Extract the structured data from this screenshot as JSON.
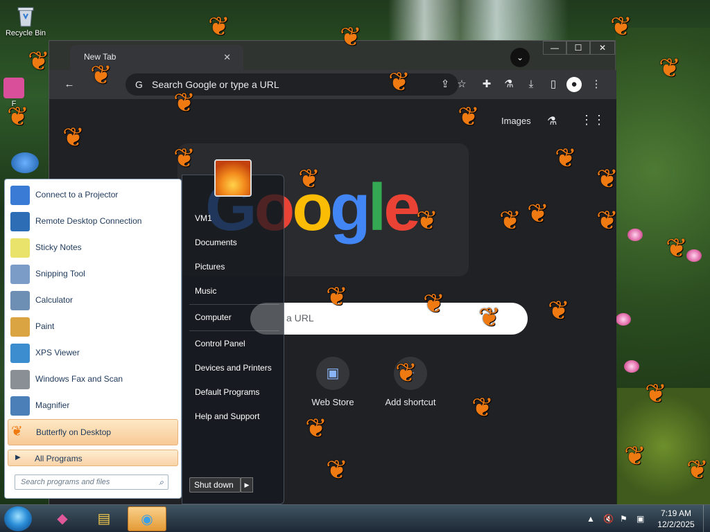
{
  "desktop": {
    "recycle_bin_label": "Recycle Bin",
    "partial_icon_label": "F"
  },
  "browser": {
    "tab_title": "New Tab",
    "tab_close": "✕",
    "tab_search_icon": "⌄",
    "window_buttons": {
      "minimize": "—",
      "maximize": "☐",
      "close": "✕"
    },
    "omnibox_placeholder": "Search Google or type a URL",
    "images_link": "Images",
    "search_placeholder": "Search Google or type a URL",
    "search_visible": "a URL",
    "shortcuts": [
      {
        "label": "Web Store",
        "icon": "web-store-icon"
      },
      {
        "label": "Add shortcut",
        "icon": "plus-icon"
      }
    ]
  },
  "start_menu": {
    "programs": [
      {
        "label": "Connect to a Projector",
        "icon": "projector-icon",
        "color": "#3a7bd5"
      },
      {
        "label": "Remote Desktop Connection",
        "icon": "remote-desktop-icon",
        "color": "#2d6db5"
      },
      {
        "label": "Sticky Notes",
        "icon": "sticky-notes-icon",
        "color": "#e9e26b"
      },
      {
        "label": "Snipping Tool",
        "icon": "scissors-icon",
        "color": "#7a9cc6"
      },
      {
        "label": "Calculator",
        "icon": "calculator-icon",
        "color": "#6c8fb3"
      },
      {
        "label": "Paint",
        "icon": "paint-palette-icon",
        "color": "#d9a441"
      },
      {
        "label": "XPS Viewer",
        "icon": "xps-viewer-icon",
        "color": "#3b8dd0"
      },
      {
        "label": "Windows Fax and Scan",
        "icon": "fax-icon",
        "color": "#8a8f96"
      },
      {
        "label": "Magnifier",
        "icon": "magnifier-icon",
        "color": "#4a7fb8"
      },
      {
        "label": "Butterfly on Desktop",
        "icon": "butterfly-icon",
        "color": "#f07a12"
      }
    ],
    "all_programs": "All Programs",
    "search_placeholder": "Search programs and files",
    "right_links": [
      "VM1",
      "Documents",
      "Pictures",
      "Music",
      "Computer",
      "Control Panel",
      "Devices and Printers",
      "Default Programs",
      "Help and Support"
    ],
    "shutdown": "Shut down"
  },
  "taskbar": {
    "pinned": [
      {
        "name": "pink-app-icon",
        "glyph": "◆",
        "color": "#e0589a"
      },
      {
        "name": "file-explorer-icon",
        "glyph": "▤",
        "color": "#f2c94c"
      },
      {
        "name": "chrome-icon",
        "glyph": "◉",
        "color": "#3aa0e8"
      }
    ],
    "time": "7:19 AM",
    "date": "12/2/2025"
  },
  "colors": {
    "accent_orange": "#f07a12",
    "chrome_dark": "#202124",
    "start_menu_text": "#1e395b"
  }
}
